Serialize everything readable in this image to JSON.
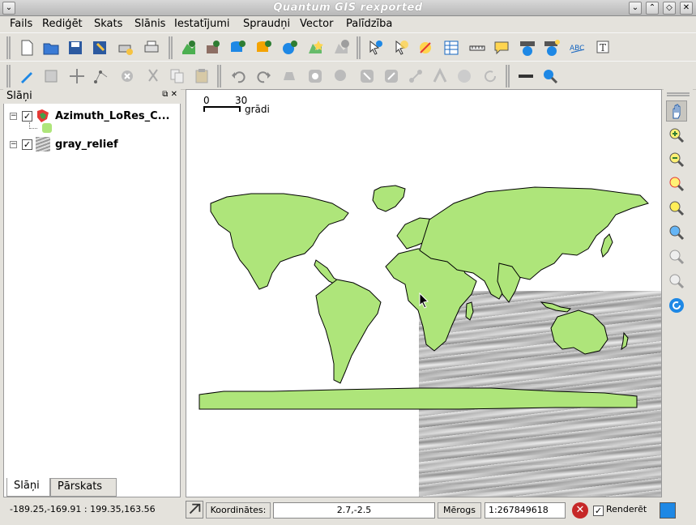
{
  "window": {
    "title": "Quantum GIS rexported"
  },
  "menu": [
    "Fails",
    "Rediģēt",
    "Skats",
    "Slānis",
    "Iestatījumi",
    "Spraudņi",
    "Vector",
    "Palīdzība"
  ],
  "layers_panel": {
    "title": "Slāņi",
    "layers": [
      {
        "name": "Azimuth_LoRes_C...",
        "checked": true,
        "fill": "#aee57a"
      },
      {
        "name": "gray_relief",
        "checked": true
      }
    ]
  },
  "tabs": [
    "Slāņi",
    "Pārskats"
  ],
  "map": {
    "scalebar": {
      "start": "0",
      "end": "30",
      "unit": "grādi"
    },
    "land_color": "#aee57a"
  },
  "status": {
    "extent": "-189.25,-169.91 : 199.35,163.56",
    "coords_label": "Koordinātes:",
    "coords_value": "2.7,-2.5",
    "scale_label": "Mērogs",
    "scale_value": "1:267849618",
    "render_label": "Renderēt",
    "render_checked": true
  }
}
